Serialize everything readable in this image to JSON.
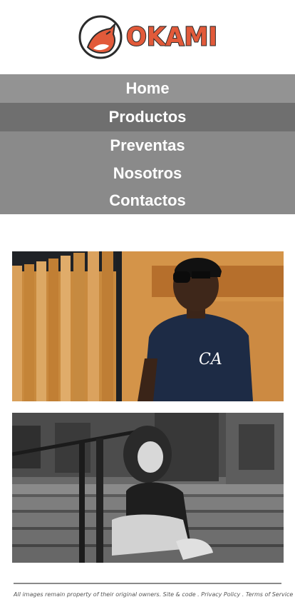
{
  "brand": {
    "name": "OKAMI",
    "logo_icon": "fox-head-icon",
    "accent_color": "#e25a3a"
  },
  "nav": {
    "items": [
      {
        "label": "Home"
      },
      {
        "label": "Productos",
        "active": true
      },
      {
        "label": "Preventas"
      },
      {
        "label": "Nosotros"
      },
      {
        "label": "Contactos"
      }
    ]
  },
  "gallery": {
    "photos": [
      {
        "subject": "man-in-sunglasses-photo",
        "shirt_text": "CA"
      },
      {
        "subject": "woman-on-stairs-photo"
      }
    ]
  },
  "footer": {
    "text": "All images remain property of their original owners. Site & code . Privacy Policy . Terms of Service"
  }
}
